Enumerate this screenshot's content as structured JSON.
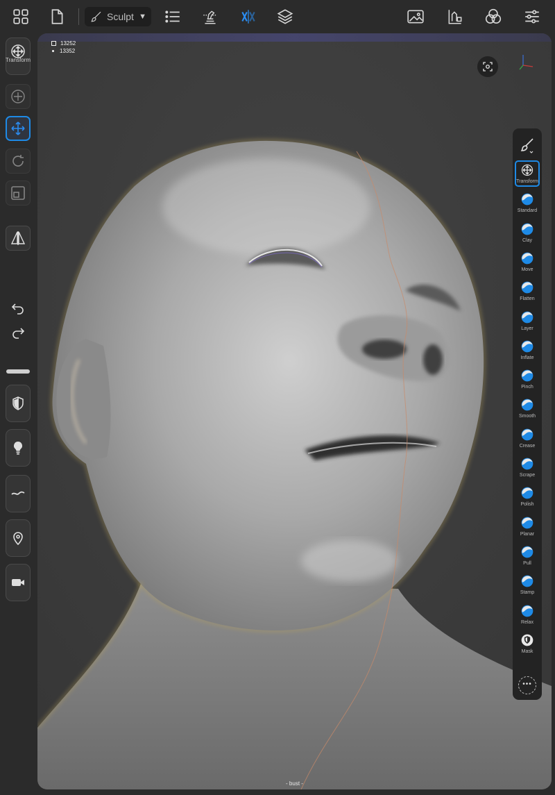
{
  "toolbar": {
    "mode_label": "Sculpt",
    "icons": [
      "grid-icon",
      "file-icon",
      "brush-icon",
      "list-icon",
      "topology-icon",
      "symmetry-icon",
      "layers-icon",
      "background-image-icon",
      "material-icon",
      "color-channels-icon",
      "settings-sliders-icon"
    ],
    "accent_color": "#1e8ae6"
  },
  "left_panel": {
    "transform_label": "Transform"
  },
  "viewport": {
    "stats": {
      "faces": "13252",
      "vertices": "13352"
    },
    "mesh_name": "- bust -",
    "background_color": "#3d3d3d"
  },
  "palette": {
    "tools": [
      {
        "key": "transform",
        "label": "Transform",
        "active": true
      },
      {
        "key": "standard",
        "label": "Standard"
      },
      {
        "key": "clay",
        "label": "Clay"
      },
      {
        "key": "move",
        "label": "Move"
      },
      {
        "key": "flatten",
        "label": "Flatten"
      },
      {
        "key": "layer",
        "label": "Layer"
      },
      {
        "key": "inflate",
        "label": "Inflate"
      },
      {
        "key": "pinch",
        "label": "Pinch"
      },
      {
        "key": "smooth",
        "label": "Smooth"
      },
      {
        "key": "crease",
        "label": "Crease"
      },
      {
        "key": "scrape",
        "label": "Scrape"
      },
      {
        "key": "polish",
        "label": "Polish"
      },
      {
        "key": "planar",
        "label": "Planar"
      },
      {
        "key": "pull",
        "label": "Pull"
      },
      {
        "key": "stamp",
        "label": "Stamp"
      },
      {
        "key": "relax",
        "label": "Relax"
      },
      {
        "key": "mask",
        "label": "Mask"
      }
    ]
  }
}
